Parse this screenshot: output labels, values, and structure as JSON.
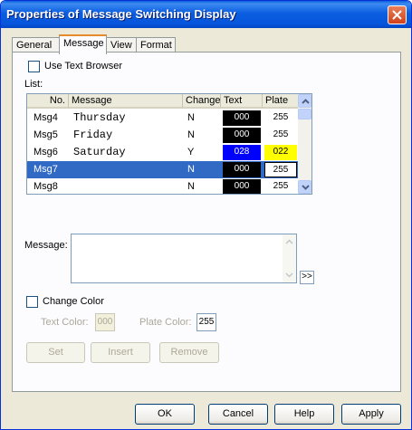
{
  "window": {
    "title": "Properties of Message Switching Display"
  },
  "tabs": [
    {
      "label": "General"
    },
    {
      "label": "Message"
    },
    {
      "label": "View"
    },
    {
      "label": "Format"
    }
  ],
  "use_text_browser": {
    "label": "Use Text Browser",
    "checked": false
  },
  "list": {
    "label": "List:",
    "columns": [
      "No.",
      "Message",
      "Change",
      "Text",
      "Plate"
    ],
    "rows": [
      {
        "no": "Msg4",
        "message": "Thursday",
        "change": "N",
        "text": "000",
        "plate": "255",
        "text_bg": "#000000",
        "plate_bg": "#ffffff"
      },
      {
        "no": "Msg5",
        "message": "Friday",
        "change": "N",
        "text": "000",
        "plate": "255",
        "text_bg": "#000000",
        "plate_bg": "#ffffff"
      },
      {
        "no": "Msg6",
        "message": "Saturday",
        "change": "Y",
        "text": "028",
        "plate": "022",
        "text_bg": "#0000ff",
        "plate_bg": "#ffff00"
      },
      {
        "no": "Msg7",
        "message": "",
        "change": "N",
        "text": "000",
        "plate": "255",
        "text_bg": "#000000",
        "plate_bg": "#ffffff",
        "selected": true
      },
      {
        "no": "Msg8",
        "message": "",
        "change": "N",
        "text": "000",
        "plate": "255",
        "text_bg": "#000000",
        "plate_bg": "#ffffff"
      }
    ]
  },
  "message": {
    "label": "Message:",
    "value": "",
    "more_label": ">>"
  },
  "change_color": {
    "label": "Change Color",
    "checked": false,
    "text_color_label": "Text Color:",
    "text_color_value": "000",
    "plate_color_label": "Plate Color:",
    "plate_color_value": "255"
  },
  "actions": {
    "set": "Set",
    "insert": "Insert",
    "remove": "Remove"
  },
  "footer": {
    "ok": "OK",
    "cancel": "Cancel",
    "help": "Help",
    "apply": "Apply"
  },
  "colors": {
    "title_bar": "#0a5fd8",
    "selection": "#316ac5",
    "tab_highlight": "#e68b2c"
  }
}
